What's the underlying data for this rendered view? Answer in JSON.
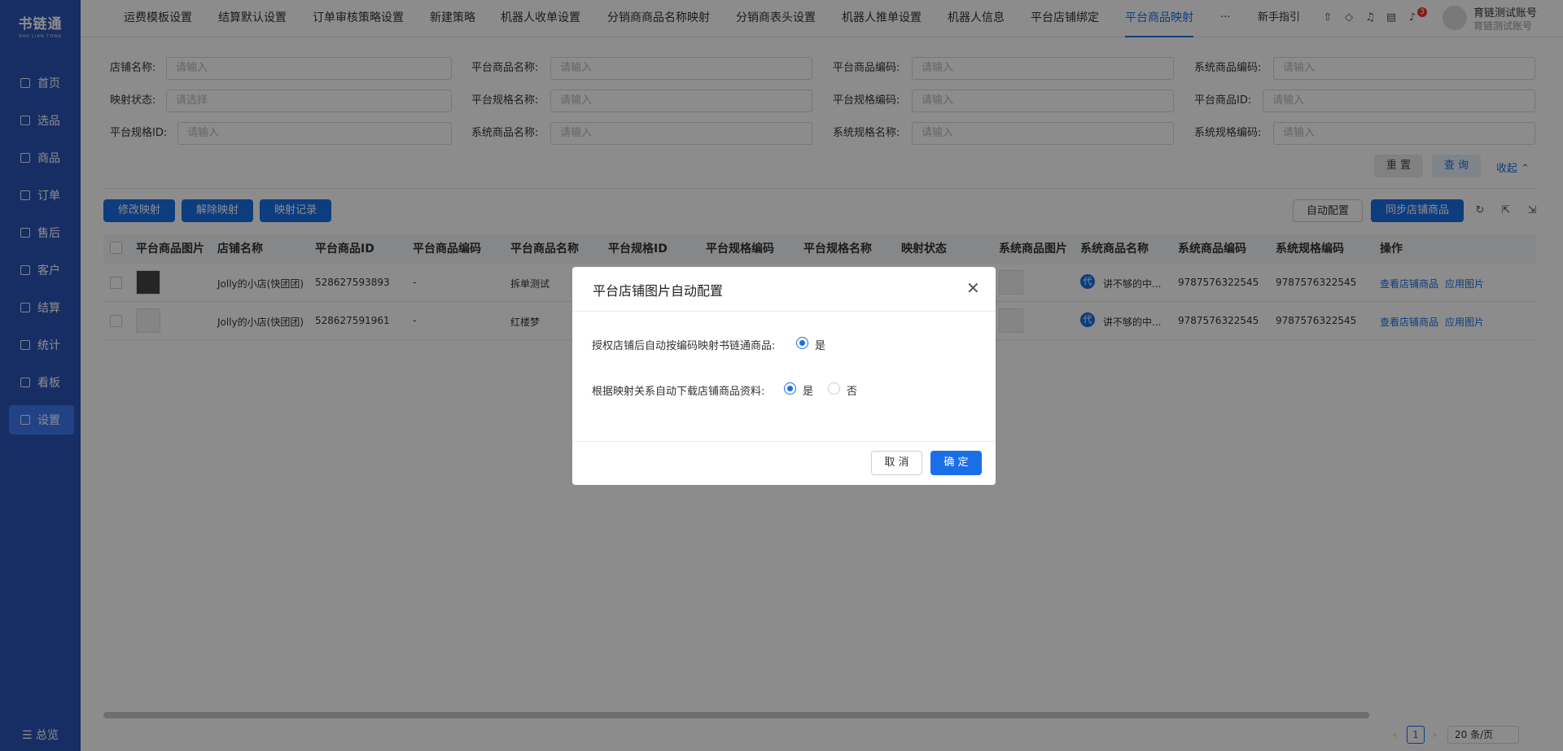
{
  "brand": {
    "name": "书链通",
    "sub": "SHU LIAN TONG"
  },
  "sidebar": {
    "items": [
      {
        "label": "首页",
        "icon": "monitor-icon"
      },
      {
        "label": "选品",
        "icon": "select-icon"
      },
      {
        "label": "商品",
        "icon": "box-icon"
      },
      {
        "label": "订单",
        "icon": "order-icon"
      },
      {
        "label": "售后",
        "icon": "refresh-icon"
      },
      {
        "label": "客户",
        "icon": "user-icon"
      },
      {
        "label": "结算",
        "icon": "settle-icon"
      },
      {
        "label": "统计",
        "icon": "chart-icon"
      },
      {
        "label": "看板",
        "icon": "board-icon"
      },
      {
        "label": "设置",
        "icon": "settings-icon"
      }
    ],
    "footer": "☰ 总览"
  },
  "tabs": [
    "运费模板设置",
    "结算默认设置",
    "订单审核策略设置",
    "新建策略",
    "机器人收单设置",
    "分销商商品名称映射",
    "分销商表头设置",
    "机器人推单设置",
    "机器人信息",
    "平台店铺绑定",
    "平台商品映射"
  ],
  "topbar": {
    "more": "···",
    "guide": "新手指引",
    "badge_count": "3",
    "user_name": "育链测试账号",
    "user_sub": "育链测试账号"
  },
  "filters": {
    "rows": [
      [
        {
          "label": "店铺名称:",
          "placeholder": "请输入"
        },
        {
          "label": "平台商品名称:",
          "placeholder": "请输入"
        },
        {
          "label": "平台商品编码:",
          "placeholder": "请输入"
        },
        {
          "label": "系统商品编码:",
          "placeholder": "请输入"
        }
      ],
      [
        {
          "label": "映射状态:",
          "placeholder": "请选择"
        },
        {
          "label": "平台规格名称:",
          "placeholder": "请输入"
        },
        {
          "label": "平台规格编码:",
          "placeholder": "请输入"
        },
        {
          "label": "平台商品ID:",
          "placeholder": "请输入"
        }
      ],
      [
        {
          "label": "平台规格ID:",
          "placeholder": "请输入"
        },
        {
          "label": "系统商品名称:",
          "placeholder": "请输入"
        },
        {
          "label": "系统规格名称:",
          "placeholder": "请输入"
        },
        {
          "label": "系统规格编码:",
          "placeholder": "请输入"
        }
      ]
    ],
    "reset": "重 置",
    "query": "查 询",
    "collapse": "收起 ⌃"
  },
  "toolbar": {
    "modify": "修改映射",
    "unbind": "解除映射",
    "records": "映射记录",
    "auto_config": "自动配置",
    "sync": "同步店铺商品"
  },
  "table": {
    "headers": [
      "平台商品图片",
      "店铺名称",
      "平台商品ID",
      "平台商品编码",
      "平台商品名称",
      "平台规格ID",
      "平台规格编码",
      "平台规格名称",
      "映射状态",
      "系统商品图片",
      "系统商品名称",
      "系统商品编码",
      "系统规格编码",
      "操作"
    ],
    "rows": [
      {
        "shop": "Jolly的小店(快团团)",
        "product_id": "528627593893",
        "code": "-",
        "name": "拆单测试",
        "sys_tag": "代",
        "sys_name": "讲不够的中...",
        "sys_code": "9787576322545",
        "sys_spec_code": "9787576322545",
        "op1": "查看店铺商品",
        "op2": "应用图片"
      },
      {
        "shop": "Jolly的小店(快团团)",
        "product_id": "528627591961",
        "code": "-",
        "name": "红楼梦",
        "sys_tag": "代",
        "sys_name": "讲不够的中...",
        "sys_code": "9787576322545",
        "sys_spec_code": "9787576322545",
        "op1": "查看店铺商品",
        "op2": "应用图片"
      }
    ]
  },
  "pagination": {
    "page": "1",
    "size": "20 条/页"
  },
  "modal": {
    "title": "平台店铺图片自动配置",
    "q1": "授权店铺后自动按编码映射书链通商品:",
    "q1_yes": "是",
    "q2": "根据映射关系自动下载店铺商品资料:",
    "q2_yes": "是",
    "q2_no": "否",
    "cancel": "取 消",
    "ok": "确 定"
  }
}
